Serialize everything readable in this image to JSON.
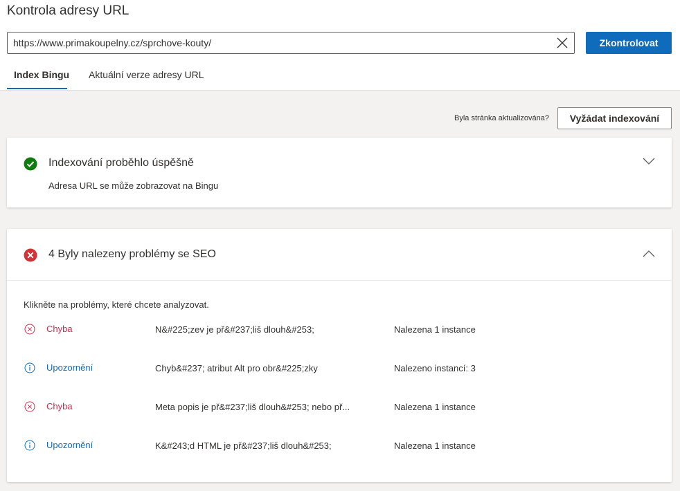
{
  "page": {
    "title": "Kontrola adresy URL",
    "url_value": "https://www.primakoupelny.cz/sprchove-kouty/",
    "check_button": "Zkontrolovat"
  },
  "tabs": [
    {
      "label": "Index Bingu",
      "active": true
    },
    {
      "label": "Aktuální verze adresy URL",
      "active": false
    }
  ],
  "actions": {
    "updated_question": "Byla stránka aktualizována?",
    "request_button": "Vyžádat indexování"
  },
  "indexing": {
    "title": "Indexování proběhlo úspěšně",
    "subtitle": "Adresa URL se může zobrazovat na Bingu",
    "icon": "success-check-icon",
    "color": "#107c10"
  },
  "seo": {
    "title": "4 Byly nalezeny problémy se SEO",
    "icon": "error-x-icon",
    "color": "#d13438",
    "hint": "Klikněte na problémy, které chcete analyzovat.",
    "issues": [
      {
        "severity": "Chyba",
        "type": "error",
        "description": "N&#225;zev je př&#237;liš dlouh&#253;",
        "count": "Nalezena 1 instance"
      },
      {
        "severity": "Upozornění",
        "type": "warning",
        "description": "Chyb&#237; atribut Alt pro obr&#225;zky",
        "count": "Nalezeno instancí: 3"
      },
      {
        "severity": "Chyba",
        "type": "error",
        "description": "Meta popis je př&#237;liš dlouh&#253; nebo př...",
        "count": "Nalezena 1 instance"
      },
      {
        "severity": "Upozornění",
        "type": "warning",
        "description": "K&#243;d HTML je př&#237;liš dlouh&#253;",
        "count": "Nalezena 1 instance"
      }
    ]
  },
  "colors": {
    "accent": "#0f6cbd",
    "error_text": "#c4314b",
    "background": "#f3f2f1"
  }
}
